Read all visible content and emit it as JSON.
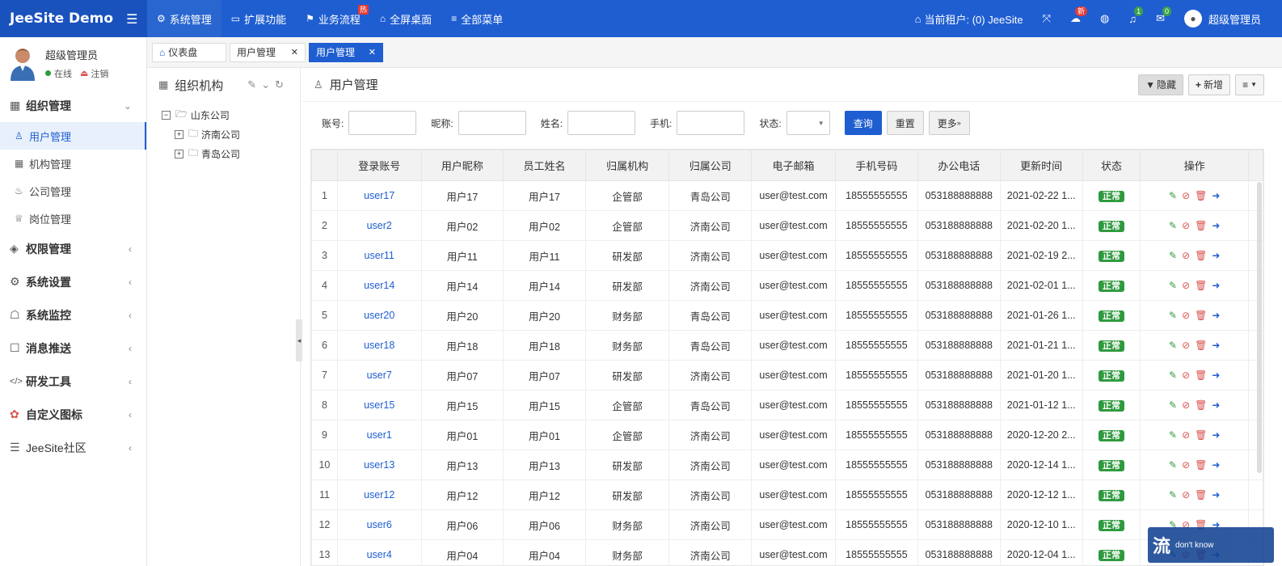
{
  "app": {
    "brand": "JeeSite Demo"
  },
  "topnav": [
    {
      "label": "系统管理",
      "icon": "gear-icon",
      "active": true
    },
    {
      "label": "扩展功能",
      "icon": "monitor-icon"
    },
    {
      "label": "业务流程",
      "icon": "flag-icon",
      "badge": "热"
    },
    {
      "label": "全屏桌面",
      "icon": "home-icon"
    },
    {
      "label": "全部菜单",
      "icon": "list-icon"
    }
  ],
  "topright": {
    "tenant": "当前租户: (0) JeeSite",
    "badge_new": "新",
    "badge_notice": "1",
    "badge_mail": "0",
    "user": "超级管理员"
  },
  "sidebar": {
    "user_name": "超级管理员",
    "status_online": "在线",
    "logout": "注销",
    "menu": [
      {
        "label": "组织管理",
        "icon": "grid-icon",
        "expanded": true,
        "children": [
          {
            "label": "用户管理",
            "icon": "user-icon",
            "active": true
          },
          {
            "label": "机构管理",
            "icon": "grid-icon"
          },
          {
            "label": "公司管理",
            "icon": "fire-icon"
          },
          {
            "label": "岗位管理",
            "icon": "trophy-icon"
          }
        ]
      },
      {
        "label": "权限管理",
        "icon": "layers-icon"
      },
      {
        "label": "系统设置",
        "icon": "gear-icon"
      },
      {
        "label": "系统监控",
        "icon": "ghost-icon"
      },
      {
        "label": "消息推送",
        "icon": "inbox-icon"
      },
      {
        "label": "研发工具",
        "icon": "code-icon"
      },
      {
        "label": "自定义图标",
        "icon": "custom-icon"
      },
      {
        "label": "JeeSite社区",
        "icon": "chat-icon"
      }
    ]
  },
  "tabs": [
    {
      "label": "仪表盘"
    },
    {
      "label": "用户管理"
    },
    {
      "label": "用户管理",
      "active": true
    }
  ],
  "tree": {
    "title": "组织机构",
    "root": "山东公司",
    "children": [
      "济南公司",
      "青岛公司"
    ]
  },
  "main": {
    "title": "用户管理",
    "btn_hide": "隐藏",
    "btn_add": "新增",
    "search": {
      "account": "账号:",
      "nickname": "昵称:",
      "name": "姓名:",
      "phone": "手机:",
      "status": "状态:",
      "query": "查询",
      "reset": "重置",
      "more": "更多"
    }
  },
  "table": {
    "headers": [
      "",
      "登录账号",
      "用户昵称",
      "员工姓名",
      "归属机构",
      "归属公司",
      "电子邮箱",
      "手机号码",
      "办公电话",
      "更新时间",
      "状态",
      "操作"
    ],
    "rows": [
      [
        "1",
        "user17",
        "用户17",
        "用户17",
        "企管部",
        "青岛公司",
        "user@test.com",
        "18555555555",
        "053188888888",
        "2021-02-22 1...",
        "正常"
      ],
      [
        "2",
        "user2",
        "用户02",
        "用户02",
        "企管部",
        "济南公司",
        "user@test.com",
        "18555555555",
        "053188888888",
        "2021-02-20 1...",
        "正常"
      ],
      [
        "3",
        "user11",
        "用户11",
        "用户11",
        "研发部",
        "济南公司",
        "user@test.com",
        "18555555555",
        "053188888888",
        "2021-02-19 2...",
        "正常"
      ],
      [
        "4",
        "user14",
        "用户14",
        "用户14",
        "研发部",
        "济南公司",
        "user@test.com",
        "18555555555",
        "053188888888",
        "2021-02-01 1...",
        "正常"
      ],
      [
        "5",
        "user20",
        "用户20",
        "用户20",
        "财务部",
        "青岛公司",
        "user@test.com",
        "18555555555",
        "053188888888",
        "2021-01-26 1...",
        "正常"
      ],
      [
        "6",
        "user18",
        "用户18",
        "用户18",
        "财务部",
        "青岛公司",
        "user@test.com",
        "18555555555",
        "053188888888",
        "2021-01-21 1...",
        "正常"
      ],
      [
        "7",
        "user7",
        "用户07",
        "用户07",
        "研发部",
        "济南公司",
        "user@test.com",
        "18555555555",
        "053188888888",
        "2021-01-20 1...",
        "正常"
      ],
      [
        "8",
        "user15",
        "用户15",
        "用户15",
        "企管部",
        "青岛公司",
        "user@test.com",
        "18555555555",
        "053188888888",
        "2021-01-12 1...",
        "正常"
      ],
      [
        "9",
        "user1",
        "用户01",
        "用户01",
        "企管部",
        "济南公司",
        "user@test.com",
        "18555555555",
        "053188888888",
        "2020-12-20 2...",
        "正常"
      ],
      [
        "10",
        "user13",
        "用户13",
        "用户13",
        "研发部",
        "济南公司",
        "user@test.com",
        "18555555555",
        "053188888888",
        "2020-12-14 1...",
        "正常"
      ],
      [
        "11",
        "user12",
        "用户12",
        "用户12",
        "研发部",
        "济南公司",
        "user@test.com",
        "18555555555",
        "053188888888",
        "2020-12-12 1...",
        "正常"
      ],
      [
        "12",
        "user6",
        "用户06",
        "用户06",
        "财务部",
        "济南公司",
        "user@test.com",
        "18555555555",
        "053188888888",
        "2020-12-10 1...",
        "正常"
      ],
      [
        "13",
        "user4",
        "用户04",
        "用户04",
        "财务部",
        "济南公司",
        "user@test.com",
        "18555555555",
        "053188888888",
        "2020-12-04 1...",
        "正常"
      ]
    ]
  },
  "watermark": "don't know"
}
